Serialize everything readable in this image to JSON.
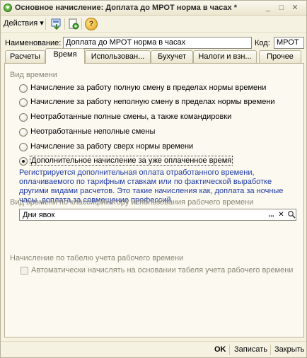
{
  "window": {
    "title": "Основное начисление: Доплата до МРОТ норма в часах *"
  },
  "toolbar": {
    "actions_label": "Действия",
    "dropdown_arrow": "▾",
    "help_glyph": "?"
  },
  "form": {
    "name_label": "Наименование:",
    "name_value": "Доплата до МРОТ норма в часах",
    "code_label": "Код:",
    "code_value": "МРОТ"
  },
  "tabs": [
    {
      "label": "Расчеты",
      "active": false
    },
    {
      "label": "Время",
      "active": true
    },
    {
      "label": "Использован...",
      "active": false
    },
    {
      "label": "Бухучет",
      "active": false
    },
    {
      "label": "Налоги и взн...",
      "active": false
    },
    {
      "label": "Прочее",
      "active": false
    }
  ],
  "time_type": {
    "heading": "Вид времени",
    "options": [
      "Начисление за работу полную смену в пределах нормы времени",
      "Начисление за работу неполную смену в пределах нормы времени",
      "Неотработанные полные смены, а также командировки",
      "Неотработанные неполные смены",
      "Начисление за работу сверх нормы времени",
      "Дополнительное начисление за уже оплаченное время"
    ],
    "selected_index": 5,
    "description": "Регистрируется дополнительная оплата отработанного времени, оплачиваемого по тарифным ставкам или по фактической выработке другими видами расчетов. Это такие начисления как, доплата за ночные часы, доплата за совмещение профессий"
  },
  "classifier": {
    "heading": "Вид времени по классификатору использования рабочего времени",
    "value": "Дни явок",
    "select_glyph": "...",
    "clear_glyph": "✕",
    "search_glyph": "🔍"
  },
  "timesheet": {
    "heading": "Начисление по табелю учета рабочего времени",
    "checkbox_label": "Автоматически начислять на основании табеля учета рабочего времени",
    "checked": false,
    "enabled": false
  },
  "footer": {
    "ok": "OK",
    "save": "Записать",
    "close": "Закрыть"
  },
  "colors": {
    "background": "#f6f2e2",
    "description_text": "#1f3aa8",
    "disabled_text": "#8a8776"
  }
}
